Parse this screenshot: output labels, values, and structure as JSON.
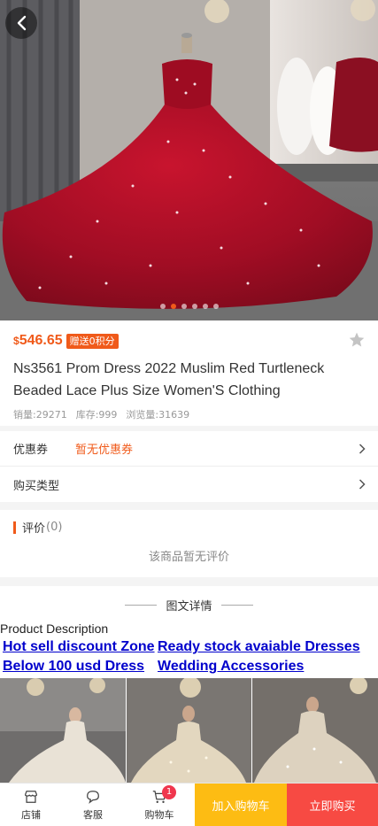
{
  "product": {
    "currency": "$",
    "price": "546.65",
    "points_badge": "赠送0积分",
    "title": "Ns3561 Prom Dress 2022 Muslim Red Turtleneck Beaded Lace Plus Size Women'S Clothing",
    "stats": {
      "sales": "销量:29271",
      "stock": "库存:999",
      "views": "浏览量:31639"
    },
    "carousel": {
      "count": 6,
      "active_index": 1
    }
  },
  "rows": {
    "coupon_label": "优惠券",
    "coupon_value": "暂无优惠券",
    "type_label": "购买类型"
  },
  "reviews": {
    "title": "评价",
    "count": "(0)",
    "empty_text": "该商品暂无评价"
  },
  "details": {
    "title": "图文详情",
    "description_heading": "Product Description",
    "links": [
      "Hot sell discount Zone",
      "Ready stock avaiable Dresses",
      "Below 100 usd Dress",
      "Wedding Accessories"
    ]
  },
  "bottom_bar": {
    "store_label": "店铺",
    "service_label": "客服",
    "cart_label": "购物车",
    "cart_badge": "1",
    "add_to_cart": "加入购物车",
    "buy_now": "立即购买"
  },
  "colors": {
    "accent": "#f05a1a",
    "cart_button": "#fdbc13",
    "buy_button": "#f74a43",
    "link": "#0000cc",
    "dress": "#b3102a"
  }
}
